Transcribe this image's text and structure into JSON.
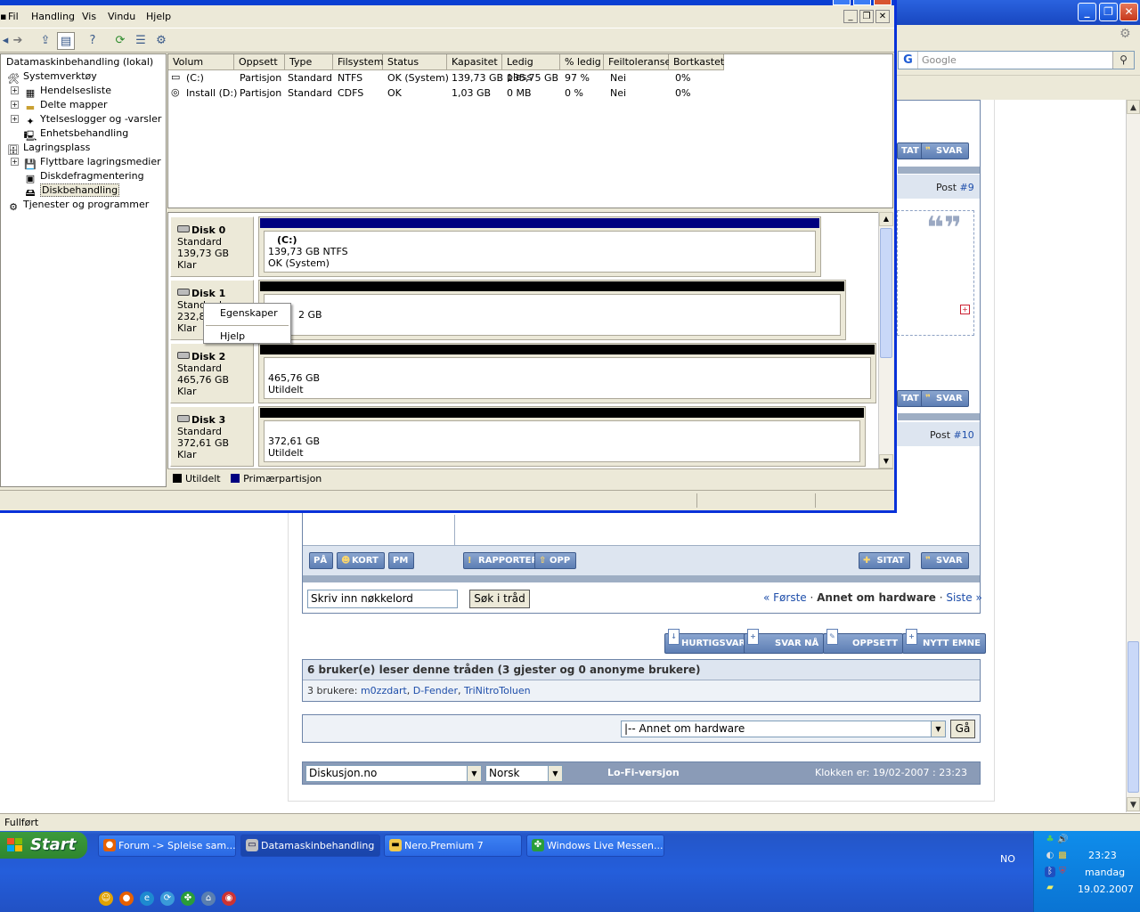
{
  "browser": {
    "search_placeholder": "Google",
    "search_engine_letter": "G",
    "status": "Fullført"
  },
  "forum": {
    "post9_label": "Post ",
    "post9_num": "#9",
    "post10_label": "Post ",
    "post10_num": "#10",
    "btn_sitat": "SITAT",
    "btn_sitat_cut": "TAT",
    "btn_svar": "SVAR",
    "btn_pa": "PÅ",
    "btn_kort": "KORT",
    "btn_pm": "PM",
    "btn_rapporter": "RAPPORTER",
    "btn_opp": "OPP",
    "keyword_value": "Skriv inn nøkkelord",
    "keyword_button": "Søk i tråd",
    "pager_first": "« Første",
    "pager_sep1": " · ",
    "pager_current": "Annet om hardware",
    "pager_sep2": " · ",
    "pager_last": "Siste »",
    "btn_hurtigsvar": "HURTIGSVAR",
    "btn_svar_na": "SVAR NÅ",
    "btn_oppsett": "OPPSETT",
    "btn_nytt_emne": "NYTT EMNE",
    "readers_header": "6 bruker(e) leser denne tråden (3 gjester og 0 anonyme brukere)",
    "readers_prefix": "3 brukere: ",
    "reader1": "m0zzdart",
    "reader2": "D-Fender",
    "reader3": "TriNitroToluen",
    "jump_select": "|-- Annet om hardware",
    "jump_button": "Gå",
    "site_select": "Diskusjon.no",
    "lang_select": "Norsk",
    "lofi": "Lo-Fi-versjon",
    "clock": "Klokken er: 19/02-2007 : 23:23"
  },
  "mmc": {
    "menu": [
      "Fil",
      "Handling",
      "Vis",
      "Vindu",
      "Hjelp"
    ],
    "tree": [
      {
        "label": "Datamaskinbehandling (lokal)"
      },
      {
        "label": "Systemverktøy"
      },
      {
        "label": "Hendelsesliste"
      },
      {
        "label": "Delte mapper"
      },
      {
        "label": "Ytelseslogger og -varsler"
      },
      {
        "label": "Enhetsbehandling"
      },
      {
        "label": "Lagringsplass"
      },
      {
        "label": "Flyttbare lagringsmedier"
      },
      {
        "label": "Diskdefragmentering"
      },
      {
        "label": "Diskbehandling"
      },
      {
        "label": "Tjenester og programmer"
      }
    ],
    "columns": [
      "Volum",
      "Oppsett",
      "Type",
      "Filsystem",
      "Status",
      "Kapasitet",
      "Ledig plass",
      "% ledig",
      "Feiltoleranse",
      "Bortkastet"
    ],
    "volumes": [
      [
        "(C:)",
        "Partisjon",
        "Standard",
        "NTFS",
        "OK (System)",
        "139,73 GB",
        "135,75 GB",
        "97 %",
        "Nei",
        "0%"
      ],
      [
        "Install (D:)",
        "Partisjon",
        "Standard",
        "CDFS",
        "OK",
        "1,03 GB",
        "0 MB",
        "0 %",
        "Nei",
        "0%"
      ]
    ],
    "disks": [
      {
        "name": "Disk 0",
        "type": "Standard",
        "size": "139,73 GB",
        "state": "Klar",
        "p_title": "(C:)",
        "p_line1": "139,73 GB NTFS",
        "p_line2": "OK (System)"
      },
      {
        "name": "Disk 1",
        "type": "Standard",
        "size": "232,8",
        "state": "Klar",
        "p_title": "",
        "p_line1": "2 GB",
        "p_line2": ""
      },
      {
        "name": "Disk 2",
        "type": "Standard",
        "size": "465,76 GB",
        "state": "Klar",
        "p_title": "",
        "p_line1": "465,76 GB",
        "p_line2": "Utildelt"
      },
      {
        "name": "Disk 3",
        "type": "Standard",
        "size": "372,61 GB",
        "state": "Klar",
        "p_title": "",
        "p_line1": "372,61 GB",
        "p_line2": "Utildelt"
      }
    ],
    "legend_unalloc": "Utildelt",
    "legend_primary": "Primærpartisjon",
    "context_menu": [
      "Egenskaper",
      "Hjelp"
    ],
    "colors": {
      "unallocated": "#000000",
      "primary": "#000080"
    }
  },
  "taskbar": {
    "start": "Start",
    "tasks": [
      "Forum -> Spleise sam...",
      "Datamaskinbehandling",
      "Nero.Premium 7",
      "Windows Live Messen..."
    ],
    "lang": "NO",
    "time": "23:23",
    "day": "mandag",
    "date": "19.02.2007"
  }
}
